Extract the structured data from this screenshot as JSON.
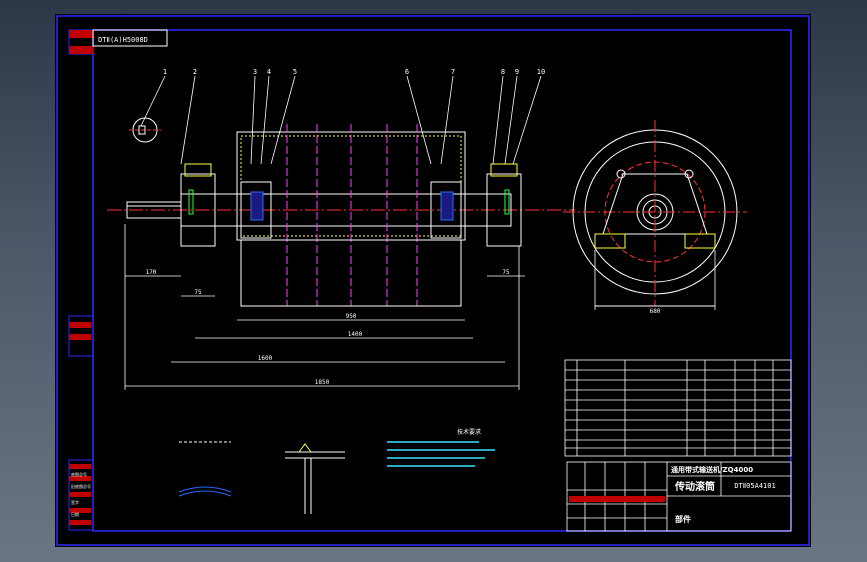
{
  "viewer": {
    "background": "#3b4656"
  },
  "colors": {
    "frame": "#2a2aff",
    "line": "#ffffff",
    "center": "#ff3030",
    "hidden": "#ff40ff",
    "dim": "#40e0ff",
    "hatch": "#ffff40",
    "green": "#30ff30"
  },
  "drawing": {
    "code_box": "DTⅡ(A)H5008D",
    "drawing_number": "DTⅡ05A4101",
    "title_block": {
      "series": "通用带式输送机/ZQ4000",
      "name": "传动滚筒",
      "type": "部件"
    },
    "balloons": [
      "1",
      "2",
      "3",
      "4",
      "5",
      "6",
      "7",
      "8",
      "9",
      "10"
    ],
    "dimensions": {
      "total_length": "1850",
      "mid_length": "1600",
      "span": "1400",
      "face_width": "950",
      "shaft_ext": "170",
      "left_offset": "75",
      "right_offset": "75",
      "flange_dia": "680"
    },
    "left_margin_labels": [
      "底图总号",
      "旧底图总号",
      "签字",
      "日期"
    ],
    "tech_requirements_title": "技术要求"
  }
}
